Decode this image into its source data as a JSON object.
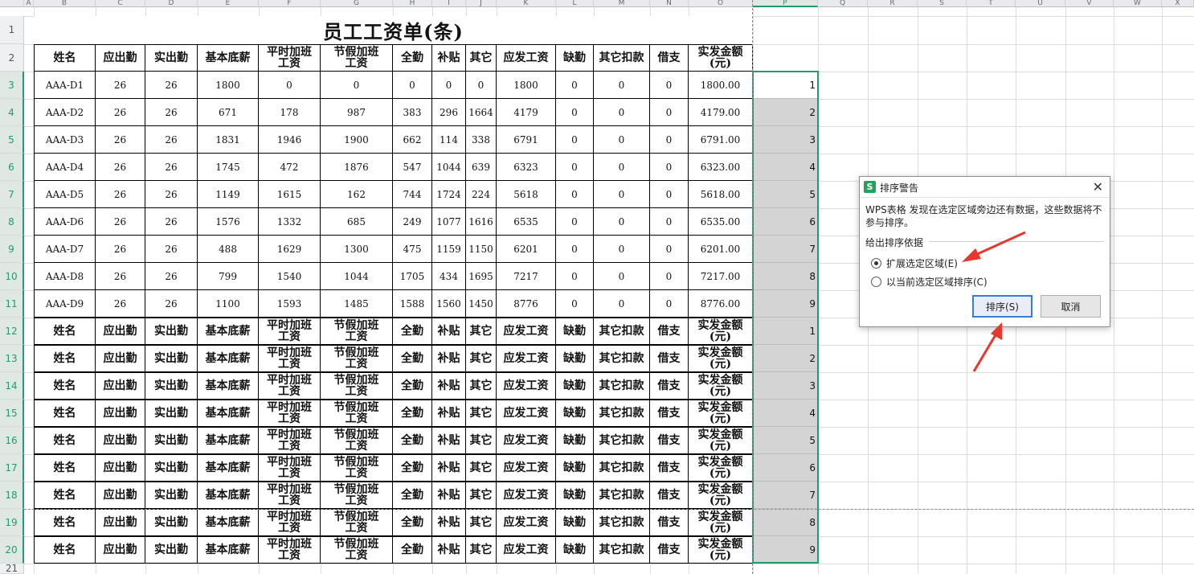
{
  "columns": [
    "A",
    "B",
    "C",
    "D",
    "E",
    "F",
    "G",
    "H",
    "I",
    "J",
    "K",
    "L",
    "M",
    "N",
    "O",
    "P",
    "Q",
    "R",
    "S",
    "T",
    "U",
    "V",
    "W",
    "X"
  ],
  "selected_column": "P",
  "row_numbers": [
    "1",
    "2",
    "3",
    "4",
    "5",
    "6",
    "7",
    "8",
    "9",
    "10",
    "11",
    "12",
    "13",
    "14",
    "15",
    "16",
    "17",
    "18",
    "19",
    "20",
    "21"
  ],
  "sheet_title": "员工工资单(条)",
  "headers": [
    "姓名",
    "应出勤",
    "实出勤",
    "基本底薪",
    "平时加班\n工资",
    "节假加班\n工资",
    "全勤",
    "补贴",
    "其它",
    "应发工资",
    "缺勤",
    "其它扣款",
    "借支",
    "实发金额\n(元)"
  ],
  "rows": [
    [
      "AAA-D1",
      "26",
      "26",
      "1800",
      "0",
      "0",
      "0",
      "0",
      "0",
      "1800",
      "0",
      "0",
      "0",
      "1800.00"
    ],
    [
      "AAA-D2",
      "26",
      "26",
      "671",
      "178",
      "987",
      "383",
      "296",
      "1664",
      "4179",
      "0",
      "0",
      "0",
      "4179.00"
    ],
    [
      "AAA-D3",
      "26",
      "26",
      "1831",
      "1946",
      "1900",
      "662",
      "114",
      "338",
      "6791",
      "0",
      "0",
      "0",
      "6791.00"
    ],
    [
      "AAA-D4",
      "26",
      "26",
      "1745",
      "472",
      "1876",
      "547",
      "1044",
      "639",
      "6323",
      "0",
      "0",
      "0",
      "6323.00"
    ],
    [
      "AAA-D5",
      "26",
      "26",
      "1149",
      "1615",
      "162",
      "744",
      "1724",
      "224",
      "5618",
      "0",
      "0",
      "0",
      "5618.00"
    ],
    [
      "AAA-D6",
      "26",
      "26",
      "1576",
      "1332",
      "685",
      "249",
      "1077",
      "1616",
      "6535",
      "0",
      "0",
      "0",
      "6535.00"
    ],
    [
      "AAA-D7",
      "26",
      "26",
      "488",
      "1629",
      "1300",
      "475",
      "1159",
      "1150",
      "6201",
      "0",
      "0",
      "0",
      "6201.00"
    ],
    [
      "AAA-D8",
      "26",
      "26",
      "799",
      "1540",
      "1044",
      "1705",
      "434",
      "1695",
      "7217",
      "0",
      "0",
      "0",
      "7217.00"
    ],
    [
      "AAA-D9",
      "26",
      "26",
      "1100",
      "1593",
      "1485",
      "1588",
      "1560",
      "1450",
      "8776",
      "0",
      "0",
      "0",
      "8776.00"
    ]
  ],
  "p_column": [
    "1",
    "2",
    "3",
    "4",
    "5",
    "6",
    "7",
    "8",
    "9",
    "1",
    "2",
    "3",
    "4",
    "5",
    "6",
    "7",
    "8",
    "9"
  ],
  "dialog": {
    "icon": "S",
    "title": "排序警告",
    "message": "WPS表格 发现在选定区域旁边还有数据，这些数据将不参与排序。",
    "group_label": "给出排序依据",
    "option_expand": "扩展选定区域(E)",
    "option_current": "以当前选定区域排序(C)",
    "selected_option": "expand",
    "sort_button": "排序(S)",
    "cancel_button": "取消"
  },
  "colors": {
    "selection": "#1e9d6a",
    "annotation_arrow": "#e8372c",
    "dialog_icon": "#1fa55b"
  }
}
